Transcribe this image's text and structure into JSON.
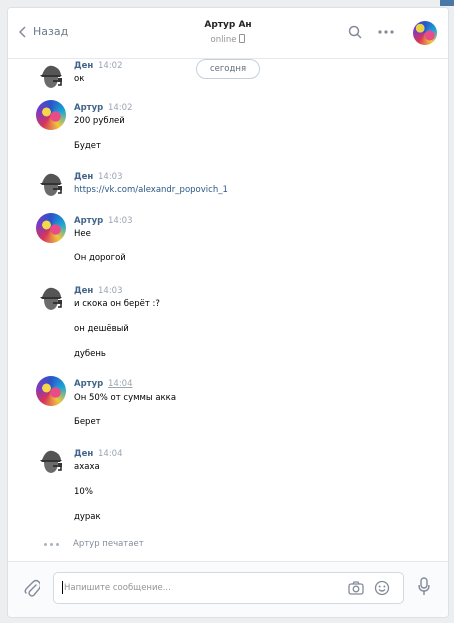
{
  "header": {
    "back_label": "Назад",
    "title": "Артур Ан",
    "status": "online"
  },
  "date_divider": "сегодня",
  "messages": [
    {
      "author": "Ден",
      "time": "14:02",
      "lines": [
        "ок"
      ]
    },
    {
      "author": "Артур",
      "time": "14:02",
      "lines": [
        "200 рублей",
        "Будет"
      ]
    },
    {
      "author": "Ден",
      "time": "14:03",
      "lines": [
        "https://vk.com/alexandr_popovich_1"
      ]
    },
    {
      "author": "Артур",
      "time": "14:03",
      "lines": [
        "Нее",
        "Он дорогой"
      ]
    },
    {
      "author": "Ден",
      "time": "14:03",
      "lines": [
        "и скока он берёт :?",
        "он дешёвый",
        "дубень"
      ]
    },
    {
      "author": "Артур",
      "time": "14:04",
      "lines": [
        "Он 50% от суммы акка",
        "Берет"
      ]
    },
    {
      "author": "Ден",
      "time": "14:04",
      "lines": [
        "ахаха",
        "10%",
        "дурак"
      ]
    }
  ],
  "typing_indicator": "Артур печатает",
  "composer": {
    "placeholder": "Напишите сообщение..."
  },
  "icons": [
    "back-chevron-icon",
    "search-icon",
    "more-icon",
    "phone-icon",
    "attach-icon",
    "camera-icon",
    "smile-icon",
    "mic-icon"
  ],
  "colors": {
    "link": "#2a5885",
    "author": "#42648b",
    "panel_bg": "#ffffff",
    "page_bg": "#edeef0"
  }
}
